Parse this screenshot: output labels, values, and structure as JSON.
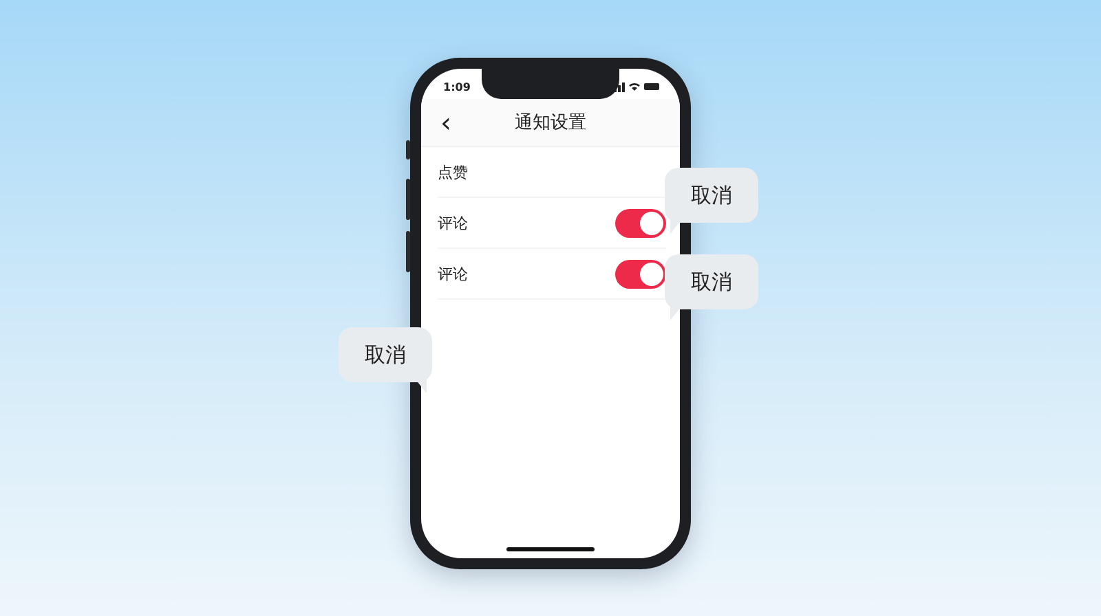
{
  "status_bar": {
    "time": "1:09"
  },
  "nav": {
    "back": "‹",
    "title": "通知设置"
  },
  "settings": [
    {
      "label": "点赞",
      "kind": "plain"
    },
    {
      "label": "评论",
      "kind": "toggle",
      "on": true
    },
    {
      "label": "评论",
      "kind": "toggle",
      "on": true
    }
  ],
  "bubbles": [
    {
      "text": "取消",
      "kind": "leftward"
    },
    {
      "text": "取消",
      "kind": "leftward"
    },
    {
      "text": "取消",
      "kind": "rightward"
    }
  ]
}
